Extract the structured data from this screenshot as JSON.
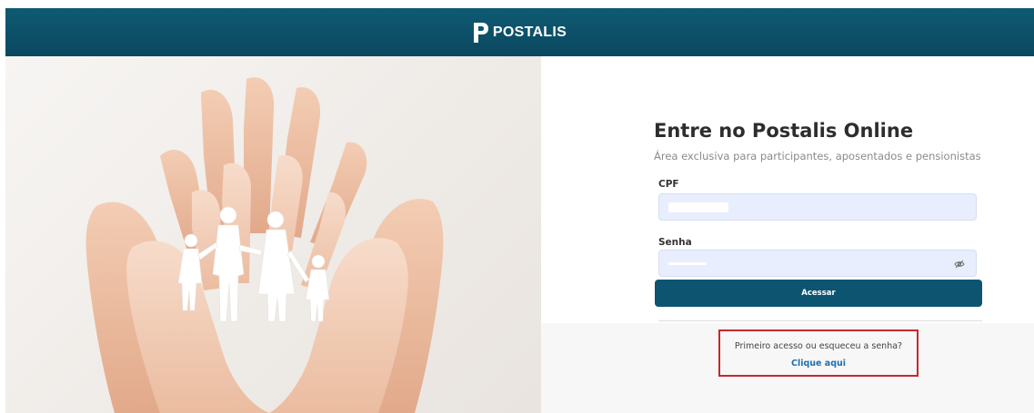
{
  "header": {
    "brand": "POSTALIS"
  },
  "hero_image": {
    "alt": "hands holding paper family cutout"
  },
  "login": {
    "title": "Entre no Postalis Online",
    "subtitle": "Área exclusiva para participantes, aposentados e pensionistas",
    "cpf_label": "CPF",
    "password_label": "Senha",
    "submit_label": "Acessar"
  },
  "help": {
    "question": "Primeiro acesso ou esqueceu a senha?",
    "link": "Clique aqui"
  },
  "colors": {
    "header_bg": "#0d5470",
    "button_bg": "#0d5470",
    "input_bg": "#e8eefd",
    "highlight_border": "#c6282e",
    "link": "#1f6fae"
  }
}
